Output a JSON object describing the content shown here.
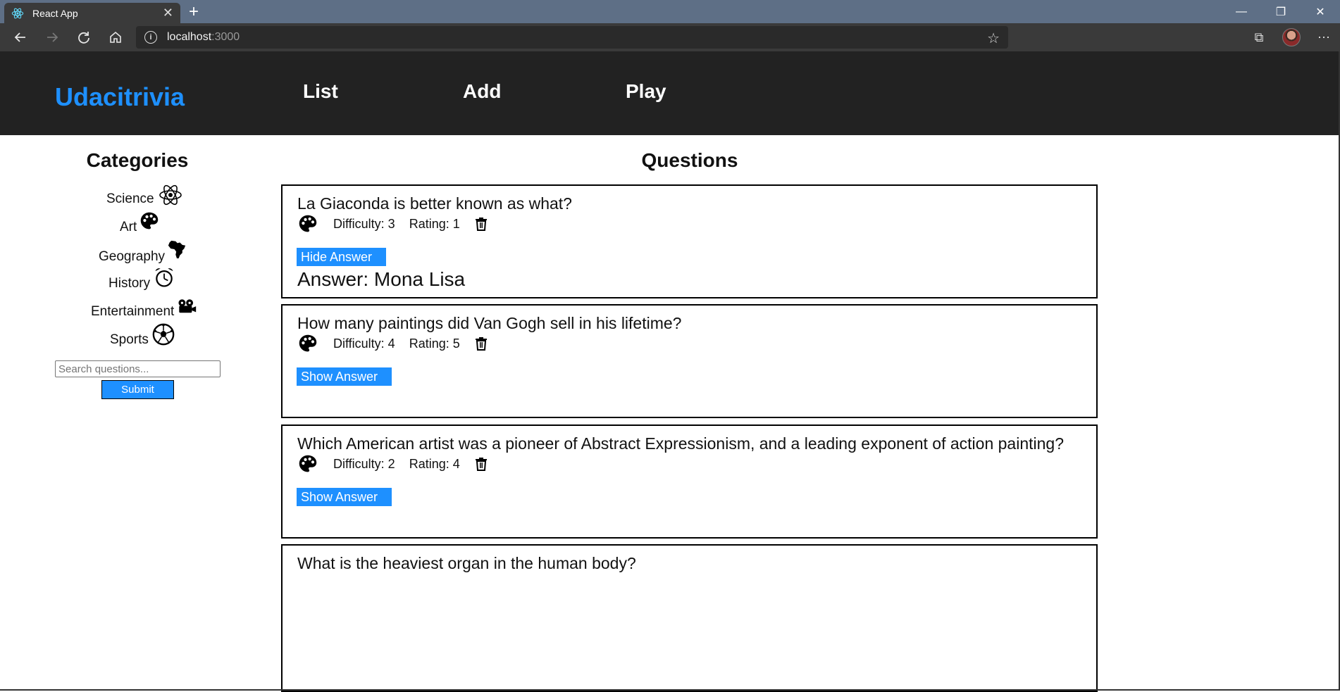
{
  "browser": {
    "tab_title": "React App",
    "url_host": "localhost",
    "url_port": ":3000"
  },
  "app": {
    "brand": "Udacitrivia",
    "nav": [
      "List",
      "Add",
      "Play"
    ]
  },
  "sidebar": {
    "title": "Categories",
    "categories": [
      {
        "label": "Science",
        "icon": "atom-icon"
      },
      {
        "label": "Art",
        "icon": "palette-icon"
      },
      {
        "label": "Geography",
        "icon": "africa-icon"
      },
      {
        "label": "History",
        "icon": "clock-icon"
      },
      {
        "label": "Entertainment",
        "icon": "film-projector-icon"
      },
      {
        "label": "Sports",
        "icon": "soccer-ball-icon"
      }
    ],
    "search_placeholder": "Search questions...",
    "submit_label": "Submit"
  },
  "questions": {
    "title": "Questions",
    "items": [
      {
        "question": "La Giaconda is better known as what?",
        "difficulty": "Difficulty: 3",
        "rating": "Rating: 1",
        "button": "Hide Answer",
        "answer": "Answer: Mona Lisa",
        "category_icon": "palette-icon"
      },
      {
        "question": "How many paintings did Van Gogh sell in his lifetime?",
        "difficulty": "Difficulty: 4",
        "rating": "Rating: 5",
        "button": "Show Answer",
        "answer": "",
        "category_icon": "palette-icon"
      },
      {
        "question": "Which American artist was a pioneer of Abstract Expressionism, and a leading exponent of action painting?",
        "difficulty": "Difficulty: 2",
        "rating": "Rating: 4",
        "button": "Show Answer",
        "answer": "",
        "category_icon": "palette-icon"
      },
      {
        "question": "What is the heaviest organ in the human body?"
      }
    ]
  },
  "colors": {
    "accent": "#1e90ff",
    "header_bg": "#222222"
  }
}
